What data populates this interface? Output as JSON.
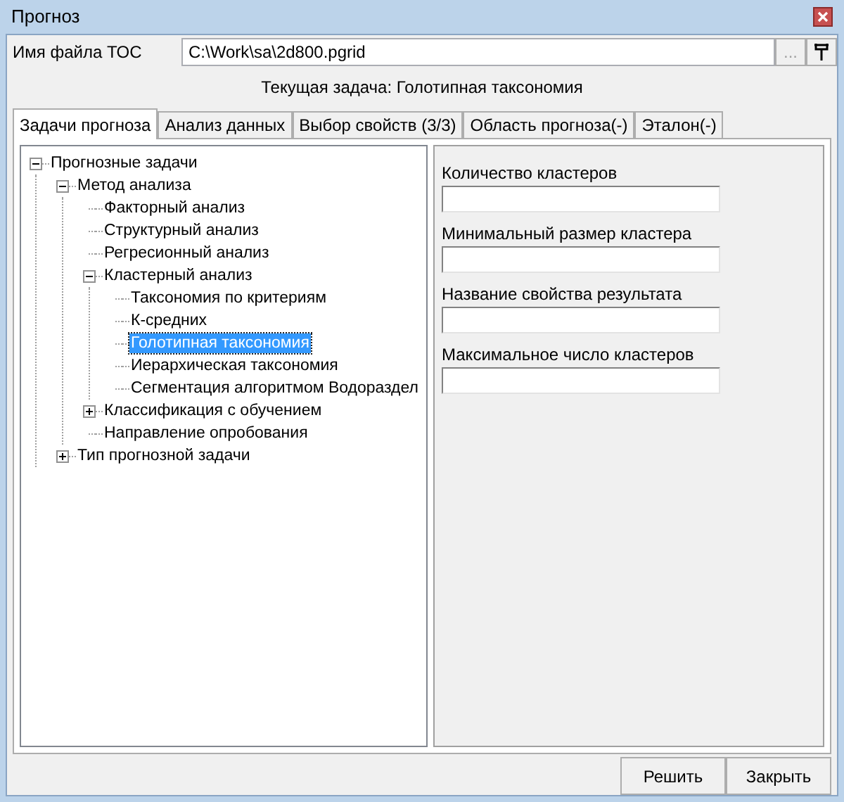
{
  "window": {
    "title": "Прогноз"
  },
  "file": {
    "label": "Имя файла ТОС",
    "value": "C:\\Work\\sa\\2d800.pgrid",
    "browse": "..."
  },
  "current_task": "Текущая задача: Голотипная таксономия",
  "tabs": [
    {
      "label": "Задачи прогноза",
      "selected": true
    },
    {
      "label": "Анализ данных",
      "selected": false
    },
    {
      "label": "Выбор свойств (3/3)",
      "selected": false
    },
    {
      "label": "Область прогноза(-)",
      "selected": false
    },
    {
      "label": "Эталон(-)",
      "selected": false
    }
  ],
  "tree": [
    {
      "label": "Прогнозные задачи",
      "expanded": true,
      "selected": false,
      "children": [
        {
          "label": "Метод анализа",
          "expanded": true,
          "selected": false,
          "children": [
            {
              "label": "Факторный анализ",
              "selected": false
            },
            {
              "label": "Структурный анализ",
              "selected": false
            },
            {
              "label": "Регресионный анализ",
              "selected": false
            },
            {
              "label": "Кластерный анализ",
              "expanded": true,
              "selected": false,
              "children": [
                {
                  "label": "Таксономия по критериям",
                  "selected": false
                },
                {
                  "label": "К-средних",
                  "selected": false
                },
                {
                  "label": "Голотипная таксономия",
                  "selected": true
                },
                {
                  "label": "Иерархическая таксономия",
                  "selected": false
                },
                {
                  "label": "Сегментация алгоритмом Водораздел",
                  "selected": false
                }
              ]
            },
            {
              "label": "Классификация с обучением",
              "expanded": false,
              "selected": false
            },
            {
              "label": "Направление опробования",
              "selected": false
            }
          ]
        },
        {
          "label": "Тип прогнозной задачи",
          "expanded": false,
          "selected": false
        }
      ]
    }
  ],
  "fields": [
    {
      "label": "Количество кластеров"
    },
    {
      "label": "Минимальный размер кластера"
    },
    {
      "label": "Название свойства результата"
    },
    {
      "label": "Максимальное число кластеров"
    }
  ],
  "buttons": [
    {
      "label": "Решить"
    },
    {
      "label": "Закрыть"
    }
  ]
}
